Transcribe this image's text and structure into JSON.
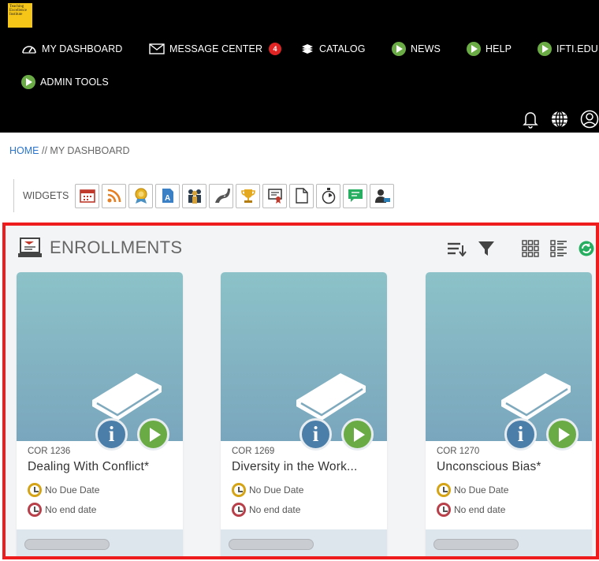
{
  "logo": {
    "text": "Teaching Excellence Institute"
  },
  "nav": {
    "items": [
      {
        "label": "MY DASHBOARD",
        "icon": "dashboard-gauge-icon"
      },
      {
        "label": "MESSAGE CENTER",
        "icon": "envelope-icon",
        "badge": "4"
      },
      {
        "label": "CATALOG",
        "icon": "books-icon"
      },
      {
        "label": "NEWS",
        "icon": "play-circle-icon"
      },
      {
        "label": "HELP",
        "icon": "play-circle-icon"
      },
      {
        "label": "IFTI.EDU",
        "icon": "play-circle-icon"
      },
      {
        "label": "ADMIN TOOLS",
        "icon": "play-circle-icon"
      }
    ],
    "utility_icons": [
      "bell-icon",
      "globe-icon",
      "user-icon"
    ]
  },
  "breadcrumb": {
    "home": "HOME",
    "separator": " // ",
    "current": "MY DASHBOARD"
  },
  "widgets": {
    "label": "WIDGETS",
    "icons": [
      "calendar-icon",
      "rss-icon",
      "award-badge-icon",
      "transcript-icon",
      "people-icon",
      "road-icon",
      "trophy-icon",
      "certificate-icon",
      "document-icon",
      "stopwatch-icon",
      "chat-icon",
      "user-admin-icon"
    ]
  },
  "enrollments": {
    "title": "ENROLLMENTS",
    "toolbar_icons": [
      "sort-icon",
      "filter-icon",
      "grid-view-icon",
      "list-view-icon",
      "refresh-icon"
    ],
    "courses": [
      {
        "code": "COR 1236",
        "title": "Dealing With Conflict*",
        "due": "No Due Date",
        "end": "No end date"
      },
      {
        "code": "COR 1269",
        "title": "Diversity in the Work...",
        "due": "No Due Date",
        "end": "No end date"
      },
      {
        "code": "COR 1270",
        "title": "Unconscious Bias*",
        "due": "No Due Date",
        "end": "No end date"
      }
    ]
  },
  "colors": {
    "accent_green": "#6aab45",
    "info_blue": "#4b7ea8",
    "badge_red": "#e02424",
    "highlight_border": "#ee1c1c"
  }
}
